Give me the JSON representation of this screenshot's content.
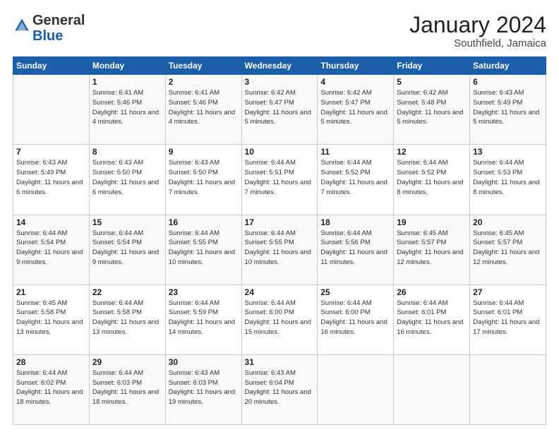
{
  "header": {
    "logo_line1": "General",
    "logo_line2": "Blue",
    "month": "January 2024",
    "location": "Southfield, Jamaica"
  },
  "days_of_week": [
    "Sunday",
    "Monday",
    "Tuesday",
    "Wednesday",
    "Thursday",
    "Friday",
    "Saturday"
  ],
  "weeks": [
    [
      {
        "day": null,
        "data": null
      },
      {
        "day": "1",
        "data": "Sunrise: 6:41 AM\nSunset: 5:46 PM\nDaylight: 11 hours\nand 4 minutes."
      },
      {
        "day": "2",
        "data": "Sunrise: 6:41 AM\nSunset: 5:46 PM\nDaylight: 11 hours\nand 4 minutes."
      },
      {
        "day": "3",
        "data": "Sunrise: 6:42 AM\nSunset: 5:47 PM\nDaylight: 11 hours\nand 5 minutes."
      },
      {
        "day": "4",
        "data": "Sunrise: 6:42 AM\nSunset: 5:47 PM\nDaylight: 11 hours\nand 5 minutes."
      },
      {
        "day": "5",
        "data": "Sunrise: 6:42 AM\nSunset: 5:48 PM\nDaylight: 11 hours\nand 5 minutes."
      },
      {
        "day": "6",
        "data": "Sunrise: 6:43 AM\nSunset: 5:49 PM\nDaylight: 11 hours\nand 5 minutes."
      }
    ],
    [
      {
        "day": "7",
        "data": "Sunrise: 6:43 AM\nSunset: 5:49 PM\nDaylight: 11 hours\nand 6 minutes."
      },
      {
        "day": "8",
        "data": "Sunrise: 6:43 AM\nSunset: 5:50 PM\nDaylight: 11 hours\nand 6 minutes."
      },
      {
        "day": "9",
        "data": "Sunrise: 6:43 AM\nSunset: 5:50 PM\nDaylight: 11 hours\nand 7 minutes."
      },
      {
        "day": "10",
        "data": "Sunrise: 6:44 AM\nSunset: 5:51 PM\nDaylight: 11 hours\nand 7 minutes."
      },
      {
        "day": "11",
        "data": "Sunrise: 6:44 AM\nSunset: 5:52 PM\nDaylight: 11 hours\nand 7 minutes."
      },
      {
        "day": "12",
        "data": "Sunrise: 6:44 AM\nSunset: 5:52 PM\nDaylight: 11 hours\nand 8 minutes."
      },
      {
        "day": "13",
        "data": "Sunrise: 6:44 AM\nSunset: 5:53 PM\nDaylight: 11 hours\nand 8 minutes."
      }
    ],
    [
      {
        "day": "14",
        "data": "Sunrise: 6:44 AM\nSunset: 5:54 PM\nDaylight: 11 hours\nand 9 minutes."
      },
      {
        "day": "15",
        "data": "Sunrise: 6:44 AM\nSunset: 5:54 PM\nDaylight: 11 hours\nand 9 minutes."
      },
      {
        "day": "16",
        "data": "Sunrise: 6:44 AM\nSunset: 5:55 PM\nDaylight: 11 hours\nand 10 minutes."
      },
      {
        "day": "17",
        "data": "Sunrise: 6:44 AM\nSunset: 5:55 PM\nDaylight: 11 hours\nand 10 minutes."
      },
      {
        "day": "18",
        "data": "Sunrise: 6:44 AM\nSunset: 5:56 PM\nDaylight: 11 hours\nand 11 minutes."
      },
      {
        "day": "19",
        "data": "Sunrise: 6:45 AM\nSunset: 5:57 PM\nDaylight: 11 hours\nand 12 minutes."
      },
      {
        "day": "20",
        "data": "Sunrise: 6:45 AM\nSunset: 5:57 PM\nDaylight: 11 hours\nand 12 minutes."
      }
    ],
    [
      {
        "day": "21",
        "data": "Sunrise: 6:45 AM\nSunset: 5:58 PM\nDaylight: 11 hours\nand 13 minutes."
      },
      {
        "day": "22",
        "data": "Sunrise: 6:44 AM\nSunset: 5:58 PM\nDaylight: 11 hours\nand 13 minutes."
      },
      {
        "day": "23",
        "data": "Sunrise: 6:44 AM\nSunset: 5:59 PM\nDaylight: 11 hours\nand 14 minutes."
      },
      {
        "day": "24",
        "data": "Sunrise: 6:44 AM\nSunset: 6:00 PM\nDaylight: 11 hours\nand 15 minutes."
      },
      {
        "day": "25",
        "data": "Sunrise: 6:44 AM\nSunset: 6:00 PM\nDaylight: 11 hours\nand 16 minutes."
      },
      {
        "day": "26",
        "data": "Sunrise: 6:44 AM\nSunset: 6:01 PM\nDaylight: 11 hours\nand 16 minutes."
      },
      {
        "day": "27",
        "data": "Sunrise: 6:44 AM\nSunset: 6:01 PM\nDaylight: 11 hours\nand 17 minutes."
      }
    ],
    [
      {
        "day": "28",
        "data": "Sunrise: 6:44 AM\nSunset: 6:02 PM\nDaylight: 11 hours\nand 18 minutes."
      },
      {
        "day": "29",
        "data": "Sunrise: 6:44 AM\nSunset: 6:03 PM\nDaylight: 11 hours\nand 18 minutes."
      },
      {
        "day": "30",
        "data": "Sunrise: 6:43 AM\nSunset: 6:03 PM\nDaylight: 11 hours\nand 19 minutes."
      },
      {
        "day": "31",
        "data": "Sunrise: 6:43 AM\nSunset: 6:04 PM\nDaylight: 11 hours\nand 20 minutes."
      },
      {
        "day": null,
        "data": null
      },
      {
        "day": null,
        "data": null
      },
      {
        "day": null,
        "data": null
      }
    ]
  ]
}
